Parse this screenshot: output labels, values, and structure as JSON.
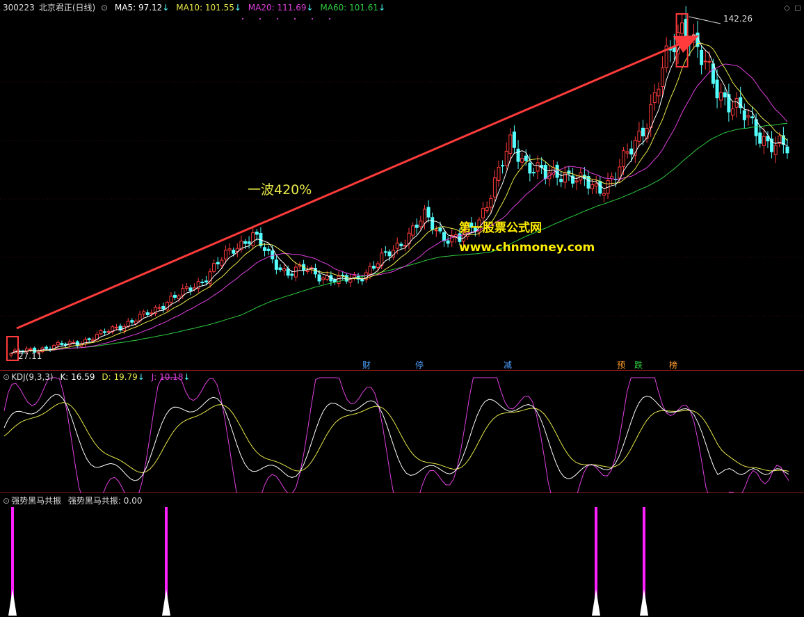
{
  "header": {
    "code": "300223",
    "name": "北京君正(日线)",
    "ma5": "MA5: 97.12",
    "ma10": "MA10: 101.55",
    "ma20": "MA20: 111.69",
    "ma60": "MA60: 101.61",
    "arrow": "↓"
  },
  "price_panel": {
    "high_label": "142.26",
    "low_label": "27.11",
    "wave_label": "一波420%",
    "watermark1": "第一股票公式网",
    "watermark2": "www.chnmoney.com",
    "event_tags": [
      {
        "text": "财",
        "color": "#4fa3ff"
      },
      {
        "text": "停",
        "color": "#4fa3ff"
      },
      {
        "text": "减",
        "color": "#4fa3ff"
      },
      {
        "text": "预",
        "color": "#ff9a2a"
      },
      {
        "text": "跌",
        "color": "#2ecc40"
      },
      {
        "text": "榜",
        "color": "#ff9a2a"
      }
    ]
  },
  "kdj_panel": {
    "title": "KDJ(9,3,3)",
    "k": "K: 16.59",
    "d": "D: 19.79",
    "j": "J: 10.18",
    "arrow": "↓"
  },
  "signal_panel": {
    "title": "强势黑马共振",
    "value_label": "强势黑马共振: 0.00"
  },
  "colors": {
    "ma5": "#ffffff",
    "ma10": "#e8e84a",
    "ma20": "#e040e0",
    "ma60": "#2ecc40",
    "up": "#ff3b3b",
    "down": "#54ffff",
    "signal": "#ff20ff"
  },
  "chart_data": [
    {
      "type": "candlestick",
      "ylim": [
        27.11,
        142.26
      ],
      "close_path": [
        27.11,
        28,
        29,
        30,
        31,
        33,
        36,
        38,
        41,
        45,
        48,
        52,
        58,
        64,
        68,
        60,
        55,
        56,
        54,
        52,
        53,
        57,
        62,
        68,
        74,
        68,
        66,
        72,
        85,
        100,
        92,
        88,
        90,
        86,
        84,
        88,
        98,
        110,
        128,
        142.26,
        128,
        118,
        112,
        105,
        100,
        97
      ],
      "series": [
        {
          "name": "MA5",
          "last": 97.12
        },
        {
          "name": "MA10",
          "last": 101.55
        },
        {
          "name": "MA20",
          "last": 111.69
        },
        {
          "name": "MA60",
          "last": 101.61
        }
      ]
    },
    {
      "type": "line",
      "ylim": [
        0,
        100
      ],
      "series": [
        {
          "name": "K",
          "last": 16.59
        },
        {
          "name": "D",
          "last": 19.79
        },
        {
          "name": "J",
          "last": 10.18
        }
      ]
    },
    {
      "type": "bar",
      "ylim": [
        0,
        1
      ],
      "signals": [
        1,
        1,
        1,
        1
      ],
      "series": [
        {
          "name": "强势黑马共振",
          "last": 0.0
        }
      ]
    }
  ]
}
